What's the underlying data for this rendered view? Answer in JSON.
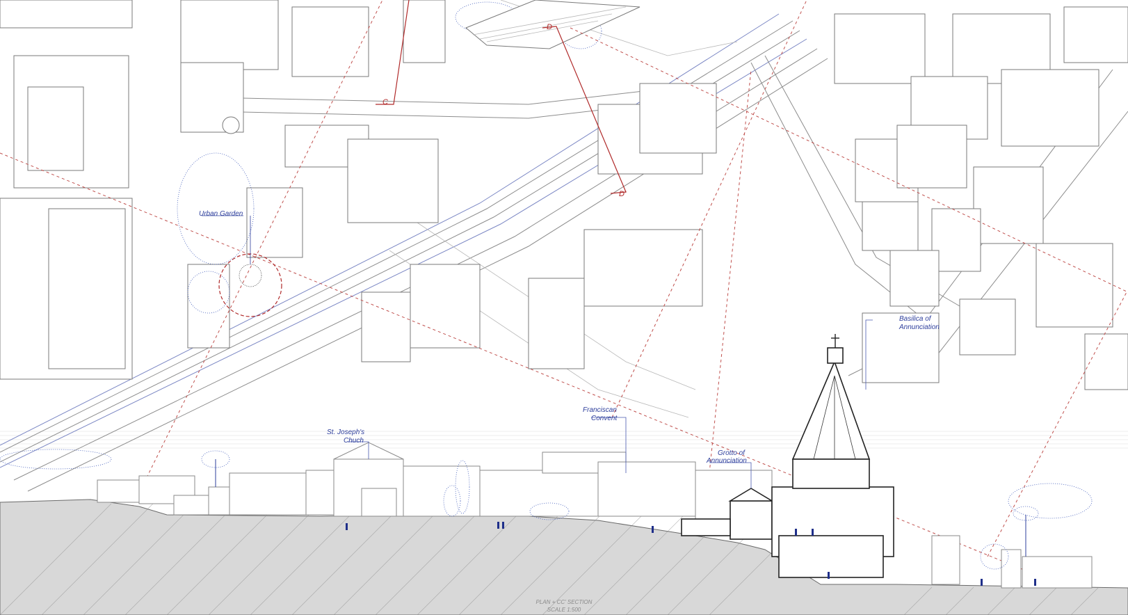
{
  "labels": {
    "urban_garden": "Urban Garden",
    "st_joseph_1": "St. Joseph's",
    "st_joseph_2": "Chuch",
    "franciscan_1": "Franciscan",
    "franciscan_2": "Convent",
    "grotto_1": "Grotto of",
    "grotto_2": "Annunciation",
    "basilica_1": "Basilica of",
    "basilica_2": "Annunciation"
  },
  "section_marks": {
    "c_mark": "C",
    "d_mark_top": "D",
    "d_mark_bottom": "D'"
  },
  "caption": {
    "line1": "PLAN + CC' SECTION",
    "line2": "SCALE 1:500"
  },
  "colors": {
    "annotation_blue": "#2e3f9c",
    "section_red": "#b02a2a",
    "linework_grey": "#7a7a7a"
  }
}
